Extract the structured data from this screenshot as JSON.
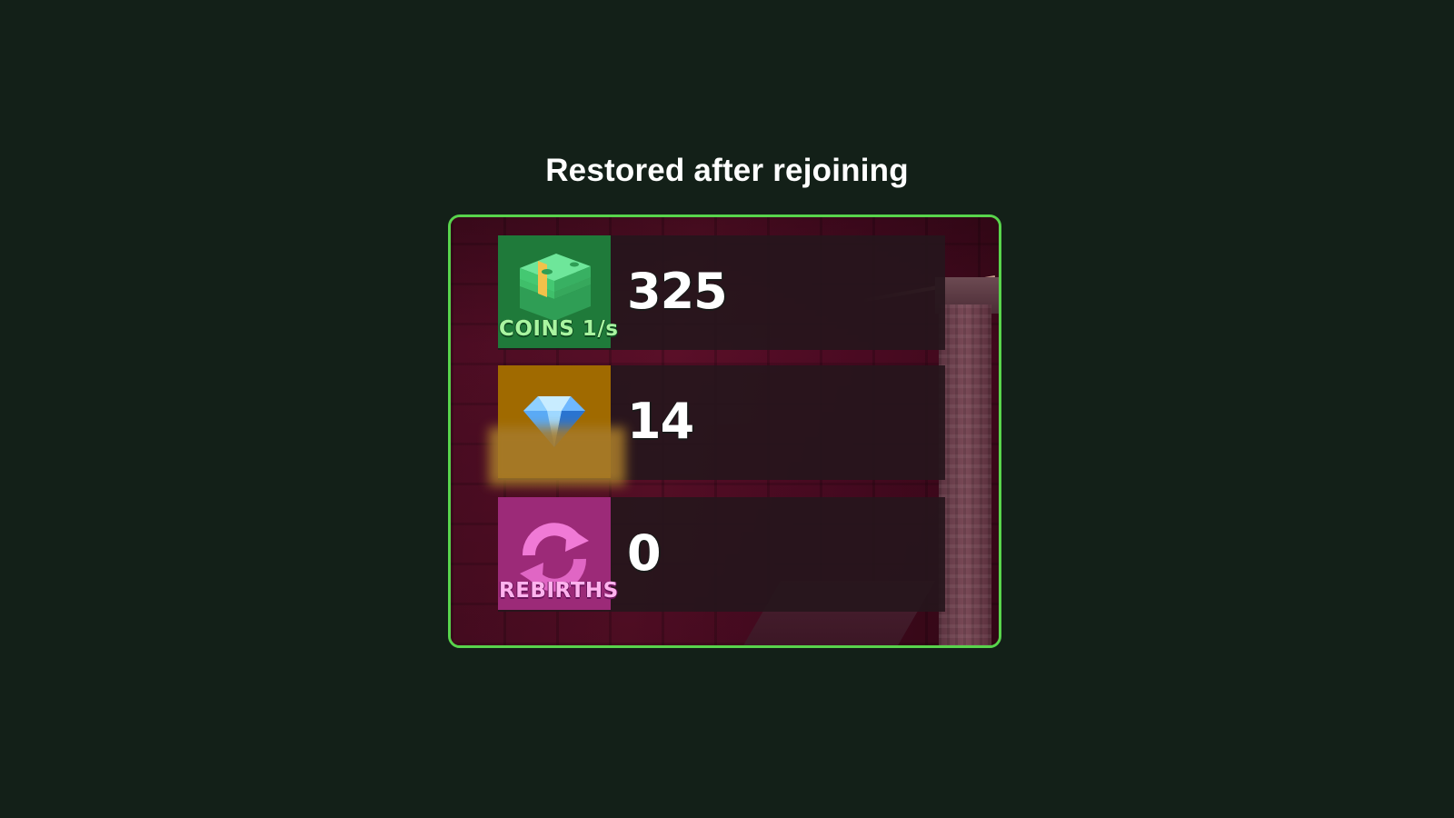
{
  "caption": "Restored after rejoining",
  "accent_color": "#58d44c",
  "stats": [
    {
      "label": "COINS 1/s",
      "value": "325",
      "icon": "cash-stack-icon",
      "tile_color": "#1f7a3a"
    },
    {
      "label": "",
      "value": "14",
      "icon": "diamond-icon",
      "tile_color": "#a06a00"
    },
    {
      "label": "REBIRTHS",
      "value": "0",
      "icon": "rebirth-arrows-icon",
      "tile_color": "#9c2a78"
    }
  ]
}
